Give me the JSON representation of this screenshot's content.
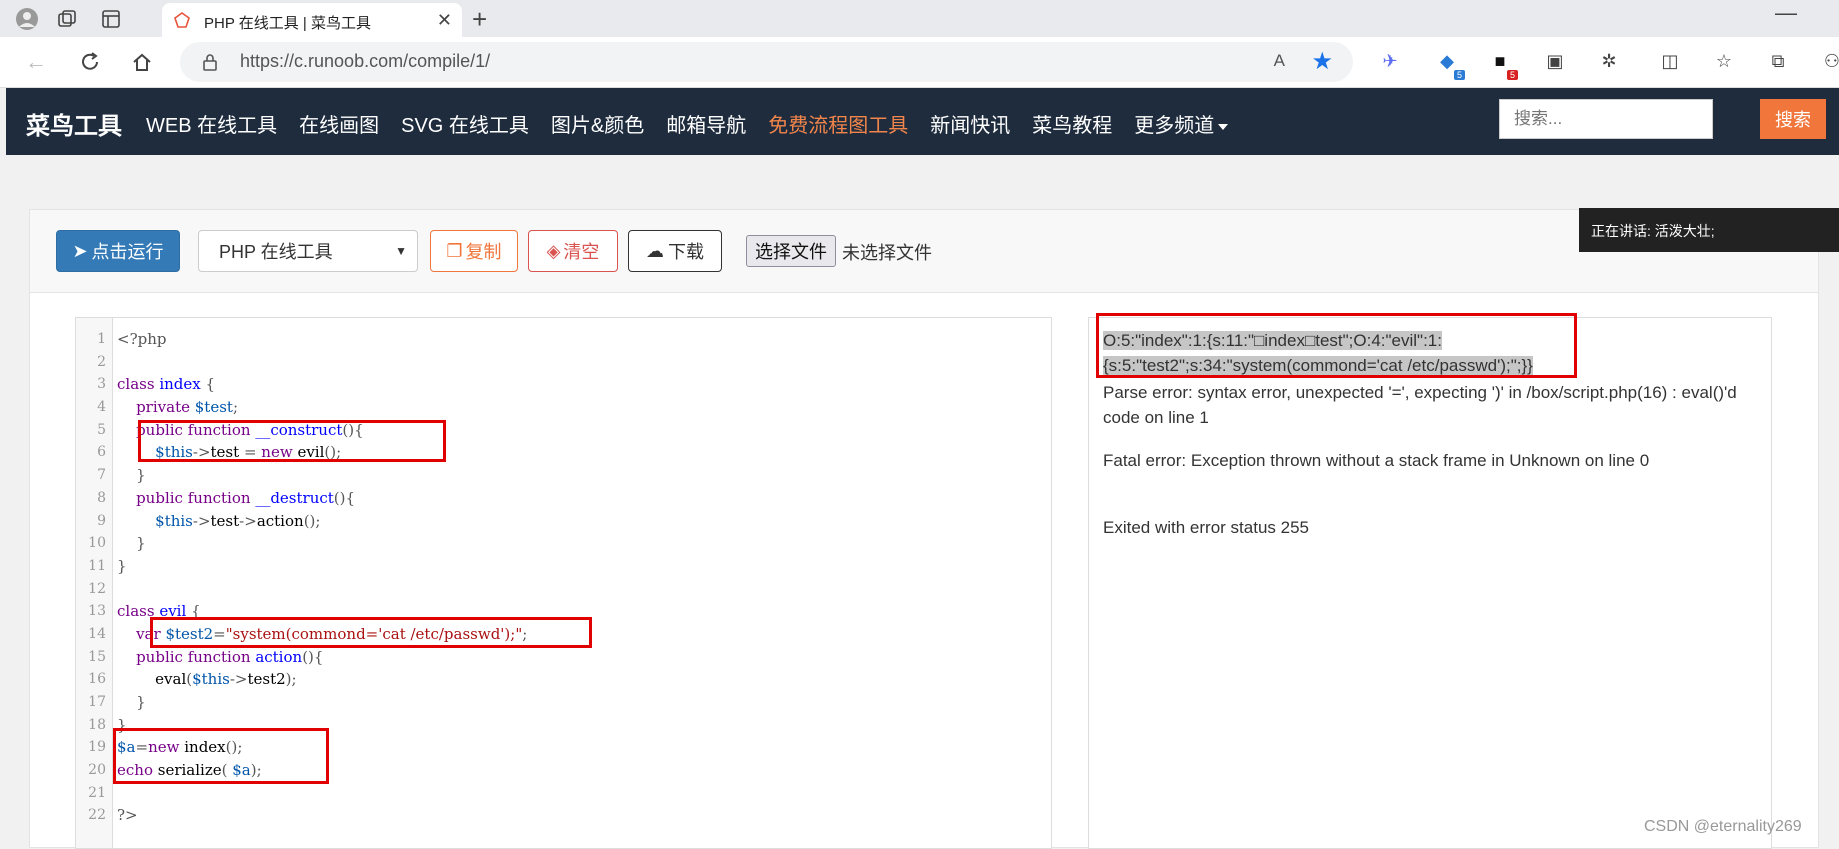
{
  "browser": {
    "tab_title": "PHP 在线工具 | 菜鸟工具",
    "url": "https://c.runoob.com/compile/1/",
    "read_aloud": "A",
    "extension_badges": [
      "5",
      "5"
    ]
  },
  "site": {
    "logo": "菜鸟工具",
    "nav": [
      "WEB 在线工具",
      "在线画图",
      "SVG 在线工具",
      "图片&颜色",
      "邮箱导航",
      "免费流程图工具",
      "新闻快讯",
      "菜鸟教程",
      "更多频道"
    ],
    "search_placeholder": "搜索...",
    "search_button": "搜索"
  },
  "toolbar": {
    "run": "点击运行",
    "language": "PHP 在线工具",
    "copy": "复制",
    "clear": "清空",
    "download": "下载",
    "file_button": "选择文件",
    "file_status": "未选择文件"
  },
  "editor": {
    "line_numbers": [
      "1",
      "2",
      "3",
      "4",
      "5",
      "6",
      "7",
      "8",
      "9",
      "10",
      "11",
      "12",
      "13",
      "14",
      "15",
      "16",
      "17",
      "18",
      "19",
      "20",
      "21",
      "22"
    ]
  },
  "output": {
    "serialized_line1": "O:5:\"index\":1:{s:11:\"□index□test\";O:4:\"evil\":1:",
    "serialized_line2": "{s:5:\"test2\";s:34:\"system(commond='cat /etc/passwd');\";}}",
    "parse_error": "Parse error: syntax error, unexpected '=', expecting ')' in /box/script.php(16) : eval()'d code on line 1",
    "fatal_error": "Fatal error: Exception thrown without a stack frame in Unknown on line 0",
    "exit_status": "Exited with error status 255"
  },
  "overlay": {
    "talking": "正在讲话:   活泼大壮;"
  },
  "watermark": "CSDN @eternality269",
  "colors": {
    "header_bg": "#1e2c3e",
    "accent_orange": "#f0763b",
    "run_blue": "#337ab7",
    "highlight_red": "#e10000"
  }
}
